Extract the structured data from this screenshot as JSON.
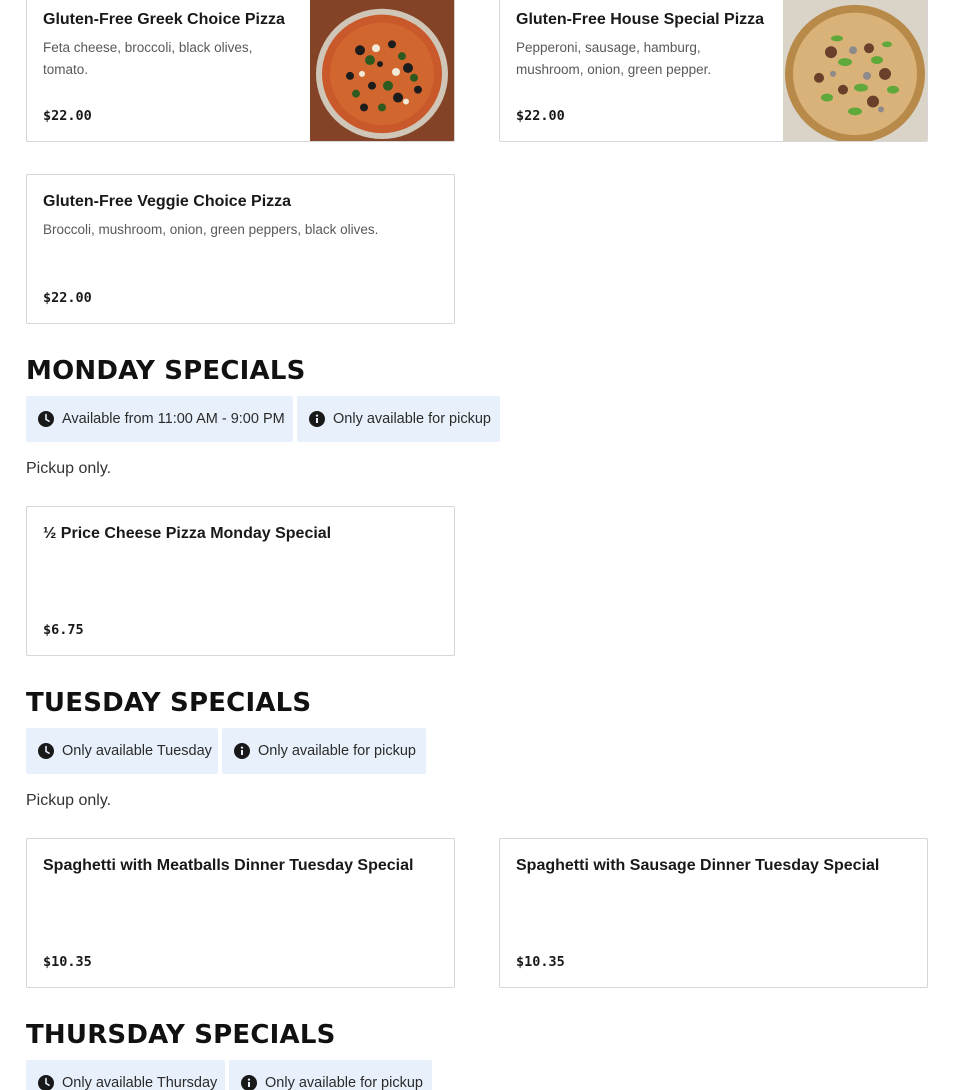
{
  "gluten_free": {
    "items": [
      {
        "name": "Gluten-Free Greek Choice Pizza",
        "desc": "Feta cheese, broccoli, black olives, tomato.",
        "price": "$22.00"
      },
      {
        "name": "Gluten-Free House Special Pizza",
        "desc": "Pepperoni, sausage, hamburg, mushroom, onion, green pepper.",
        "price": "$22.00"
      },
      {
        "name": "Gluten-Free Veggie Choice Pizza",
        "desc": "Broccoli, mushroom, onion, green peppers, black olives.",
        "price": "$22.00"
      }
    ]
  },
  "monday": {
    "title": "MONDAY SPECIALS",
    "chip_time": "Available from 11:00 AM - 9:00 PM",
    "chip_pickup": "Only available for pickup",
    "note": "Pickup only.",
    "items": [
      {
        "name": "½ Price Cheese Pizza Monday Special",
        "price": "$6.75"
      }
    ]
  },
  "tuesday": {
    "title": "TUESDAY SPECIALS",
    "chip_time": "Only available Tuesday",
    "chip_pickup": "Only available for pickup",
    "note": "Pickup only.",
    "items": [
      {
        "name": "Spaghetti with Meatballs Dinner Tuesday Special",
        "price": "$10.35"
      },
      {
        "name": "Spaghetti with Sausage Dinner Tuesday Special",
        "price": "$10.35"
      }
    ]
  },
  "thursday": {
    "title": "THURSDAY SPECIALS",
    "chip_time": "Only available Thursday",
    "chip_pickup": "Only available for pickup"
  }
}
